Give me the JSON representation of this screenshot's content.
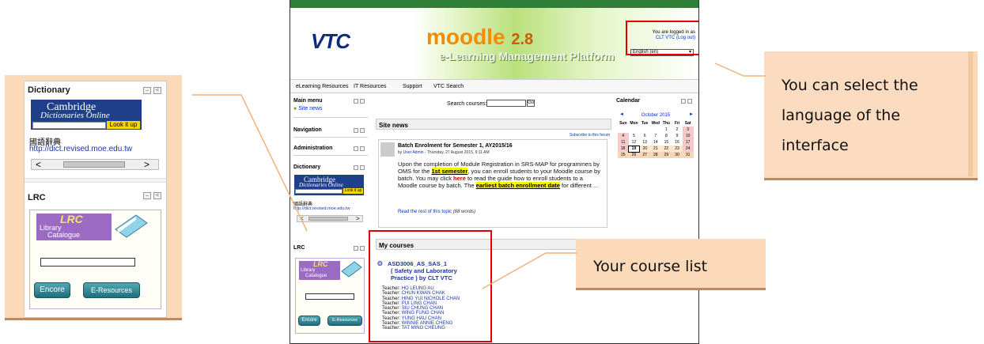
{
  "left_callout": {
    "dictionary_title": "Dictionary",
    "cambridge_line1": "Cambridge",
    "cambridge_line2": "Dictionaries Online",
    "lookup_button": "Look it up",
    "chinese_dict": "國語辭典",
    "chinese_dict_url": "http://dict.revised.moe.edu.tw",
    "lrc_title": "LRC",
    "lrc_banner": "LRC",
    "lrc_sub1": "Library",
    "lrc_sub2": "Catalogue",
    "encore_button": "Encore",
    "eresources_button": "E-Resources",
    "scroll_left": "<",
    "scroll_right": ">"
  },
  "header": {
    "logo": "VTC",
    "moodle": "moodle",
    "moodle_version": "2.8",
    "tagline": "e-Learning Management Platform",
    "logged_in_text": "You are logged in as",
    "user_link": "CLT VTC",
    "logout_link": "(Log out)",
    "language": "English (en)"
  },
  "navbar": [
    "eLearning Resources",
    "IT Resources",
    "Support",
    "VTC Search"
  ],
  "left_col": {
    "main_menu": "Main menu",
    "site_news": "Site news",
    "navigation": "Navigation",
    "administration": "Administration",
    "dictionary": "Dictionary",
    "cambridge_line1": "Cambridge",
    "cambridge_line2": "Dictionaries Online",
    "lookup_button": "Look it up",
    "chinese_dict": "國語辭典",
    "chinese_dict_url": "http://dict.revised.moe.edu.tw",
    "lrc": "LRC",
    "lrc_banner": "LRC",
    "lrc_sub1": "Library",
    "lrc_sub2": "Catalogue",
    "encore": "Encore",
    "eresources": "E-Resources",
    "scroll_left": "<",
    "scroll_right": ">"
  },
  "main": {
    "search_label": "Search courses:",
    "go_button": "Go",
    "site_news_heading": "Site news",
    "subscribe": "Subscribe to this forum",
    "post_title": "Batch Enrolment for Semester 1, AY2015/16",
    "post_by_prefix": "by",
    "post_author": "User Admin",
    "post_date": "- Thursday, 27 August 2015, 9:11 AM",
    "post_body_1": "Upon the completion of Module Registration in SRS-MAP for programmes by OMS for the ",
    "post_highlight_1": "1st semester",
    "post_body_2": ", you can enroll students to your Moodle course by batch. You may click ",
    "post_link_here": "here",
    "post_body_3": " to read the guide how to enroll students to a Moodle course by batch. The ",
    "post_highlight_2": "earliest batch enrollment date",
    "post_body_4": " for different ...",
    "read_more": "Read the rest of this topic",
    "read_more_count": "(68 words)",
    "my_courses_heading": "My courses",
    "course_line1": "ASD3006_AS_SAS_1",
    "course_line2": "( Safety and Laboratory",
    "course_line3": "Practice ) by CLT VTC",
    "teacher_label": "Teacher:",
    "teachers": [
      "HO LEUNG AU",
      "CHUN KWAN CHAK",
      "HING YUI NICHOLE CHAN",
      "PUI LING CHAN",
      "SIU CHUNG CHAN",
      "WING FUNG CHAN",
      "YUNG HAU CHAN",
      "WINNIE ANNIE CHENG",
      "TAT MING CHEUNG"
    ]
  },
  "calendar": {
    "title": "Calendar",
    "prev": "◄",
    "next": "►",
    "month": "October 2015",
    "days": [
      "Sun",
      "Mon",
      "Tue",
      "Wed",
      "Thu",
      "Fri",
      "Sat"
    ],
    "weeks": [
      [
        "",
        "",
        "",
        "",
        "1",
        "2",
        "3"
      ],
      [
        "4",
        "5",
        "6",
        "7",
        "8",
        "9",
        "10"
      ],
      [
        "11",
        "12",
        "13",
        "14",
        "15",
        "16",
        "17"
      ],
      [
        "18",
        "19",
        "20",
        "21",
        "22",
        "23",
        "24"
      ],
      [
        "25",
        "26",
        "27",
        "28",
        "29",
        "30",
        "31"
      ]
    ]
  },
  "callouts": {
    "language_lines": [
      "You can select the",
      "language of the",
      "interface"
    ],
    "courses": "Your course list"
  },
  "colors": {
    "callout_bg": "#fbd9b9",
    "highlight_red": "#e00000",
    "link_blue": "#0033cc",
    "vtc_green": "#2f7e37"
  }
}
